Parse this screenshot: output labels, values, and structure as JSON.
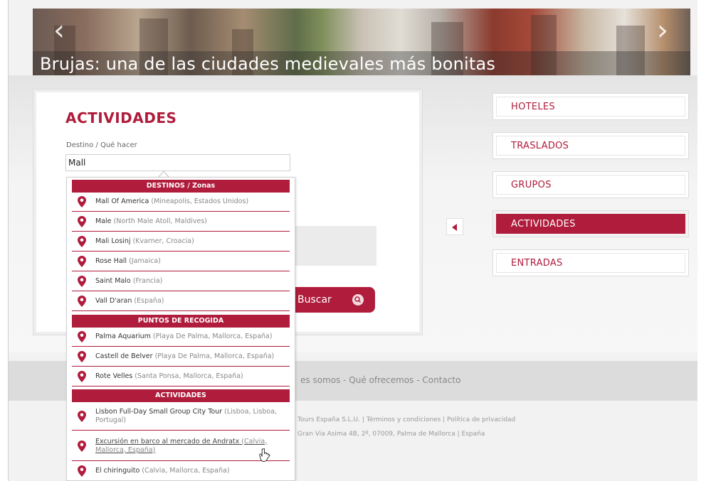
{
  "hero": {
    "title": "Brujas: una de las ciudades medievales más bonitas",
    "prev_symbol": "‹",
    "next_symbol": "›"
  },
  "form": {
    "title": "ACTIVIDADES",
    "destination_label": "Destino / Qué hacer",
    "destination_value": "Mall",
    "search_button": "Buscar"
  },
  "menu": {
    "items": [
      {
        "label": "HOTELES",
        "active": false
      },
      {
        "label": "TRASLADOS",
        "active": false
      },
      {
        "label": "GRUPOS",
        "active": false
      },
      {
        "label": "ACTIVIDADES",
        "active": true
      },
      {
        "label": "ENTRADAS",
        "active": false
      }
    ]
  },
  "dropdown": {
    "sections": [
      {
        "header": "DESTINOS / Zonas",
        "items": [
          {
            "name": "Mall Of America",
            "location": "(Mineapolis, Estados Unidos)"
          },
          {
            "name": "Male",
            "location": "(North Male Atoll, Maldives)"
          },
          {
            "name": "Mali Losinj",
            "location": "(Kvarner, Croacia)"
          },
          {
            "name": "Rose Hall",
            "location": "(Jamaica)"
          },
          {
            "name": "Saint Malo",
            "location": "(Francia)"
          },
          {
            "name": "Vall D'aran",
            "location": "(España)"
          }
        ]
      },
      {
        "header": "PUNTOS DE RECOGIDA",
        "items": [
          {
            "name": "Palma Aquarium",
            "location": "(Playa De Palma, Mallorca, España)"
          },
          {
            "name": "Castell de Belver",
            "location": "(Playa De Palma, Mallorca, España)"
          },
          {
            "name": "Rote Velles",
            "location": "(Santa Ponsa, Mallorca, España)"
          }
        ]
      },
      {
        "header": "ACTIVIDADES",
        "items": [
          {
            "name": "Lisbon Full-Day Small Group City Tour",
            "location": "(Lisboa, Lisboa, Portugal)"
          },
          {
            "name": "Excursión en barco al mercado de Andratx",
            "location": "(Calvia, Mallorca, España)"
          },
          {
            "name": "El chiringuito",
            "location": "(Calvia, Mallorca, España)"
          }
        ]
      }
    ]
  },
  "footer": {
    "links_fragment": "es somos - Qué ofrecemos - Contacto",
    "legal_fragment": "Tours España S.L.U. | Términos y condiciones | Política de privacidad",
    "address_fragment": "Gran Via Asima 4B, 2º, 07009, Palma de Mallorca | España"
  },
  "colors": {
    "accent": "#b01c3c",
    "panel_bg": "#ffffff",
    "page_bg": "#f2f2f2"
  },
  "icons": {
    "pin": "map-pin-icon",
    "search": "search-icon",
    "pointer": "triangle-left-icon"
  }
}
